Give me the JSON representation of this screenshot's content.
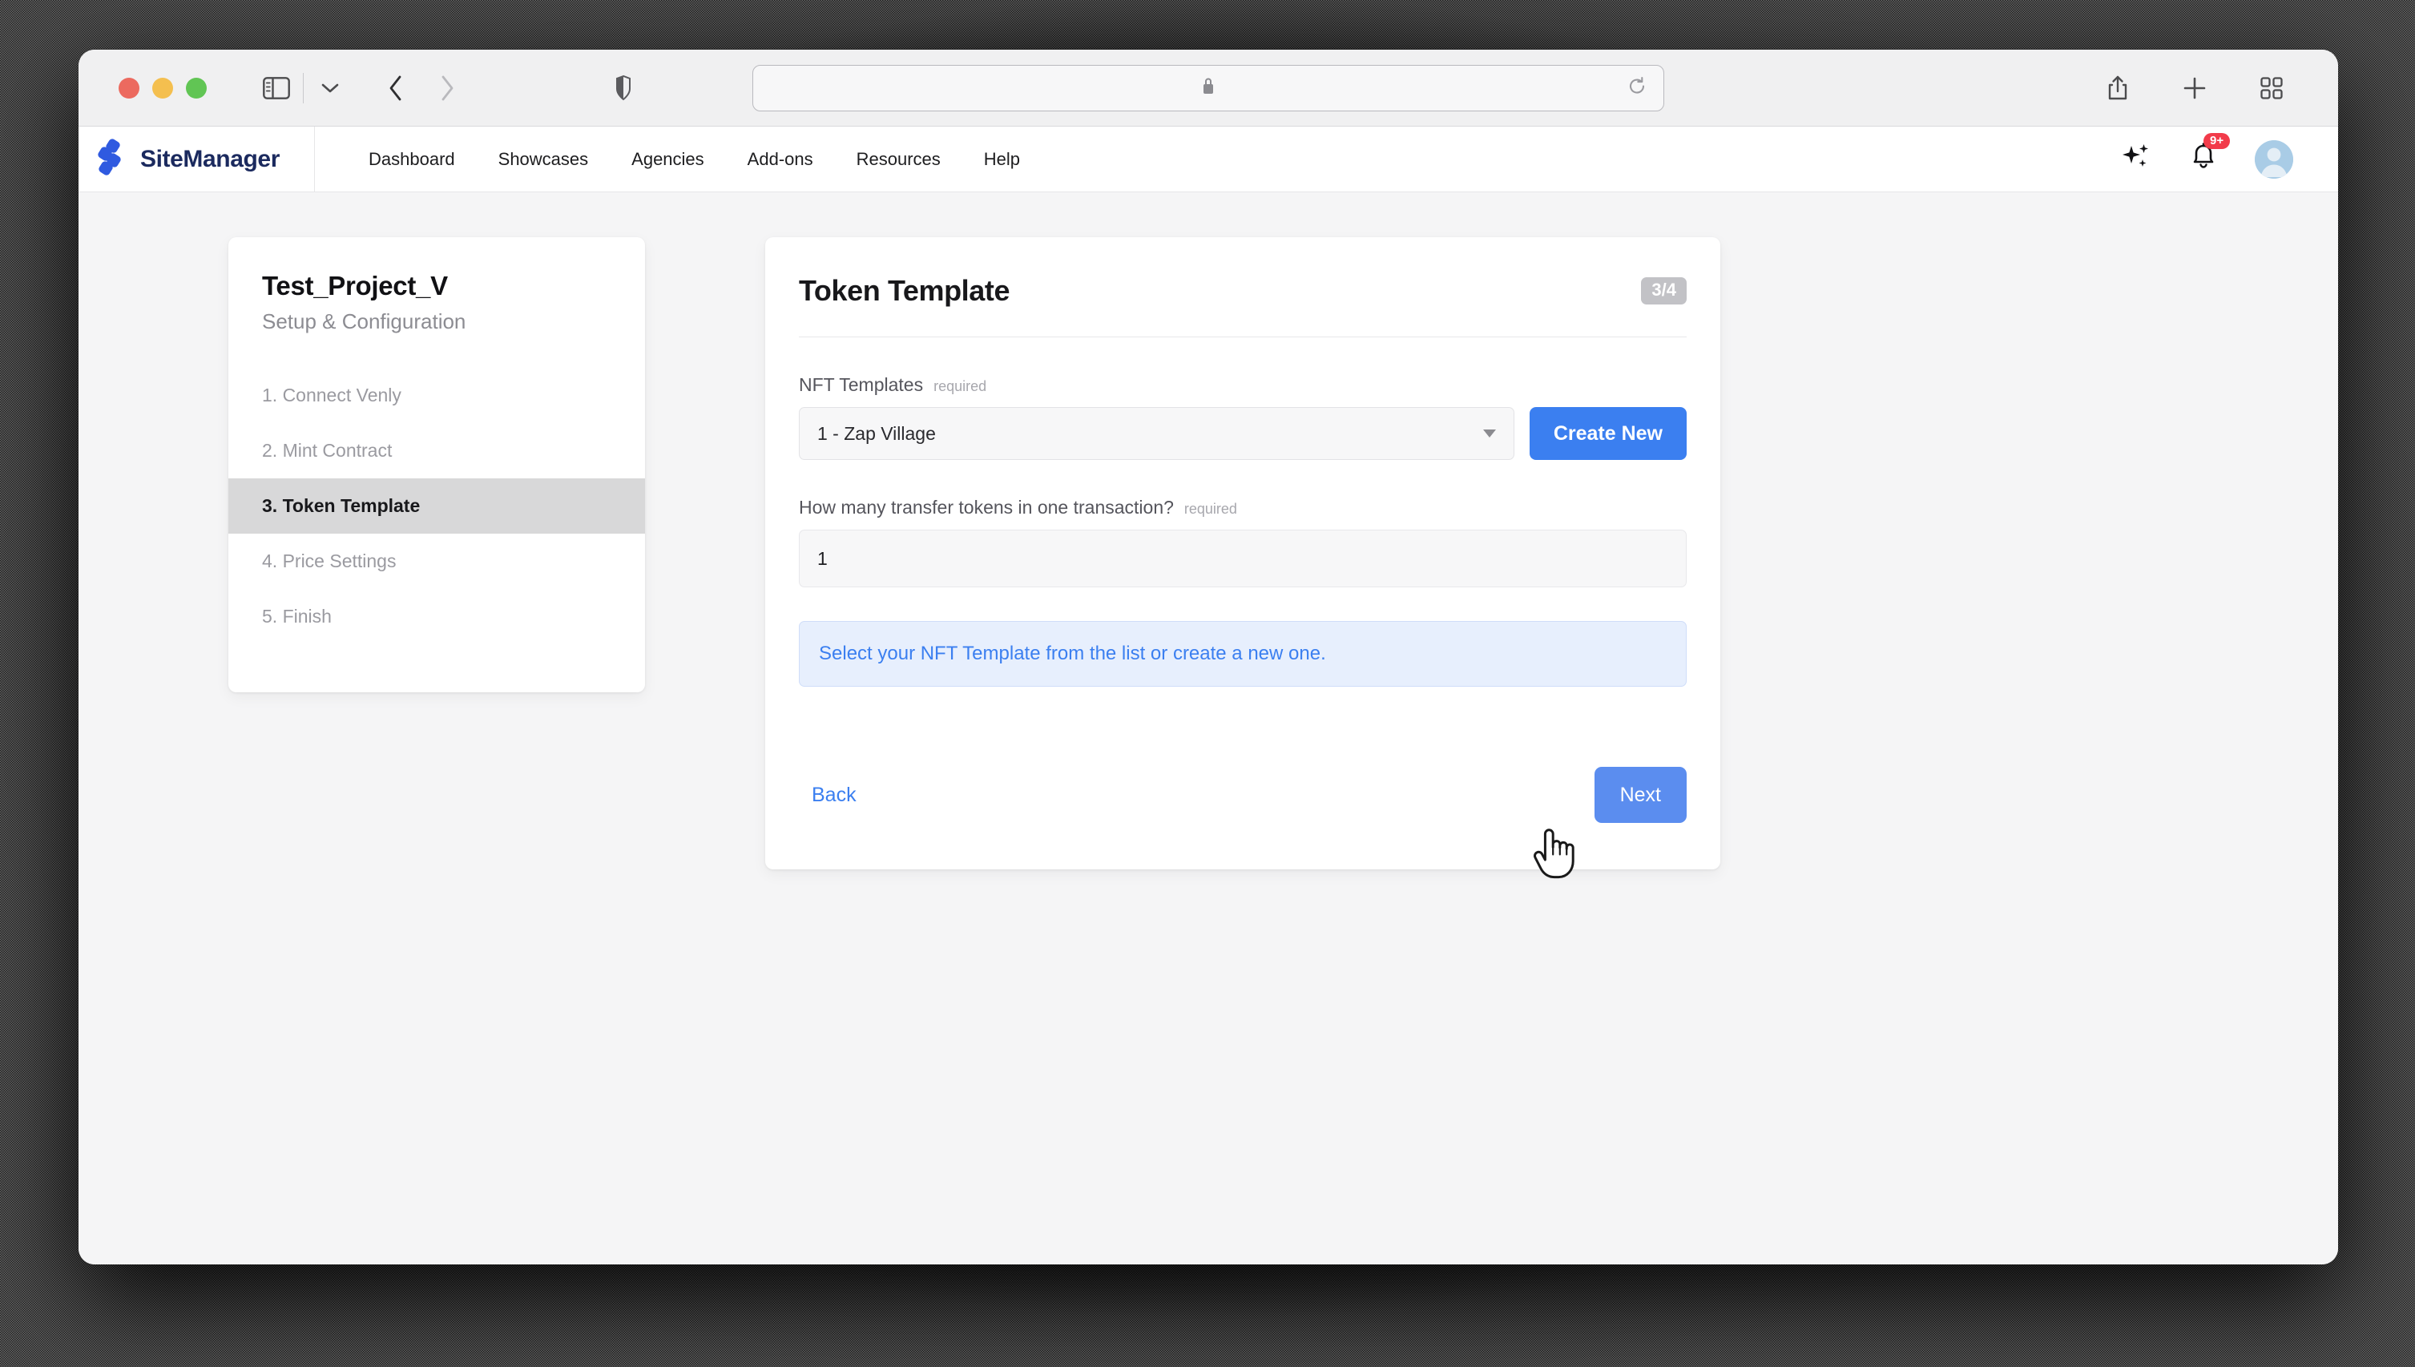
{
  "browser": {
    "traffic_lights": [
      "close-red",
      "minimize-yellow",
      "zoom-green"
    ],
    "sidebar_toggle_icon": "sidebar-icon",
    "tab_overview_chevron_icon": "chevron-down-icon",
    "back_icon": "chevron-left-icon",
    "forward_icon": "chevron-right-icon",
    "shield_icon": "shield-icon",
    "address_value": "",
    "address_placeholder": "",
    "lock_icon": "lock-icon",
    "reload_icon": "reload-icon",
    "share_icon": "share-icon",
    "new_tab_icon": "plus-icon",
    "tabs_icon": "tab-grid-icon"
  },
  "app_nav": {
    "brand": "SiteManager",
    "logo_icon": "sitemanager-diamond-logo",
    "links": [
      {
        "label": "Dashboard"
      },
      {
        "label": "Showcases"
      },
      {
        "label": "Agencies"
      },
      {
        "label": "Add-ons"
      },
      {
        "label": "Resources"
      },
      {
        "label": "Help"
      }
    ],
    "sparkle_icon": "sparkle-icon",
    "bell_icon": "bell-icon",
    "bell_badge": "9+",
    "avatar_icon": "user-avatar"
  },
  "wizard": {
    "title": "Test_Project_V",
    "subtitle": "Setup & Configuration",
    "steps": [
      {
        "label": "1. Connect Venly",
        "active": false
      },
      {
        "label": "2. Mint Contract",
        "active": false
      },
      {
        "label": "3. Token Template",
        "active": true
      },
      {
        "label": "4. Price Settings",
        "active": false
      },
      {
        "label": "5. Finish",
        "active": false
      }
    ]
  },
  "main": {
    "title": "Token Template",
    "step_badge": "3/4",
    "nft_templates": {
      "label": "NFT Templates",
      "required_tag": "required",
      "selected_value": "1 - Zap Village",
      "create_button": "Create New",
      "caret_icon": "chevron-down-icon"
    },
    "transfer_tokens": {
      "label": "How many transfer tokens in one transaction?",
      "required_tag": "required",
      "value": "1",
      "placeholder": ""
    },
    "alert_text": "Select your NFT Template from the list or create a new one.",
    "back_button": "Back",
    "next_button": "Next"
  },
  "colors": {
    "brand_blue": "#3b7ff0",
    "next_blue": "#5b8def",
    "brand_navy": "#1b2a5e",
    "badge_gray": "#c2c2c6",
    "alert_bg": "#e7effd",
    "badge_red": "#f23b4a",
    "page_bg": "#f5f5f6"
  },
  "cursor": {
    "type": "pointing-hand"
  }
}
